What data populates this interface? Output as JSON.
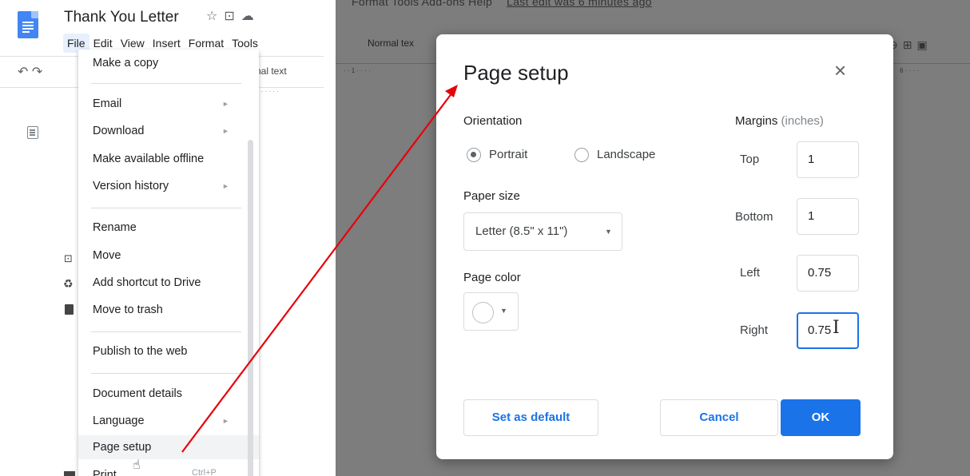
{
  "document": {
    "title": "Thank You Letter",
    "title_icons": [
      "star-icon",
      "folder-move-icon",
      "cloud-status-icon"
    ]
  },
  "menubar": {
    "file": "File",
    "edit": "Edit",
    "view": "View",
    "insert": "Insert",
    "format": "Format",
    "tools": "Tools"
  },
  "toolbar": {
    "normal_text_partial": "nal text",
    "ruler_partial": "1"
  },
  "file_menu": {
    "items": [
      {
        "label": "Make a copy"
      },
      {
        "label": "Email",
        "submenu": true
      },
      {
        "label": "Download",
        "submenu": true
      },
      {
        "label": "Make available offline"
      },
      {
        "label": "Version history",
        "submenu": true
      },
      {
        "label": "Rename"
      },
      {
        "label": "Move",
        "icon": "move-folder-icon"
      },
      {
        "label": "Add shortcut to Drive",
        "icon": "drive-shortcut-icon"
      },
      {
        "label": "Move to trash",
        "icon": "trash-icon"
      },
      {
        "label": "Publish to the web"
      },
      {
        "label": "Document details"
      },
      {
        "label": "Language",
        "submenu": true
      },
      {
        "label": "Page setup"
      },
      {
        "label": "Print",
        "shortcut": "Ctrl+P"
      }
    ]
  },
  "right_bg": {
    "menubar_text": "Format   Tools   Add-ons   Help",
    "last_edit": "Last edit was 6 minutes ago",
    "normal_text_partial": "Normal tex",
    "ruler_left": "1",
    "ruler_right": "6"
  },
  "page_setup": {
    "title": "Page setup",
    "close": "×",
    "orientation_heading": "Orientation",
    "portrait": "Portrait",
    "landscape": "Landscape",
    "selected_orientation": "Portrait",
    "paper_size_heading": "Paper size",
    "paper_size_value": "Letter (8.5\" x 11\")",
    "page_color_heading": "Page color",
    "page_color_value": "#ffffff",
    "margins_heading": "Margins",
    "margins_unit": "(inches)",
    "margins": {
      "top_label": "Top",
      "top": "1",
      "bottom_label": "Bottom",
      "bottom": "1",
      "left_label": "Left",
      "left": "0.75",
      "right_label": "Right",
      "right": "0.75"
    },
    "set_default": "Set as default",
    "cancel": "Cancel",
    "ok": "OK"
  },
  "colors": {
    "accent": "#1a73e8",
    "annotation_arrow": "#e8000b",
    "overlay": "#7d7d7d"
  }
}
